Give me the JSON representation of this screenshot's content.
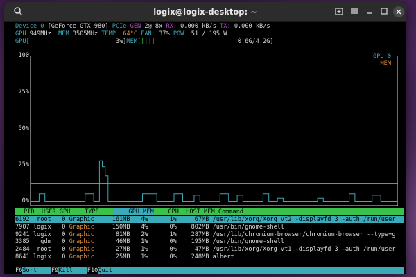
{
  "window": {
    "title": "logix@logix-desktop: ~"
  },
  "icons": {
    "search": "search-icon",
    "new_tab": "new-tab-icon",
    "menu": "hamburger-menu-icon",
    "minimize": "minimize-icon",
    "maximize": "maximize-icon",
    "close": "close-icon"
  },
  "device": {
    "line1": {
      "device_label": "Device",
      "device_id": "0",
      "gpu_name": "[GeForce GTX 980]",
      "pcie_label": "PCIe",
      "gen_label": "GEN",
      "gen_value": "2@ 8x",
      "rx_label": "RX:",
      "rx_value": "0.000 kB/s",
      "tx_label": "TX:",
      "tx_value": "0.000 kB/s"
    },
    "line2": {
      "gpu_label": "GPU",
      "gpu_clock": "949MHz",
      "mem_label": "MEM",
      "mem_clock": "3505MHz",
      "temp_label": "TEMP",
      "temp_value": "64°C",
      "fan_label": "FAN",
      "fan_value": "37%",
      "pow_label": "POW",
      "pow_value": "51 / 195 W"
    },
    "line3": {
      "gpu_label": "GPU[",
      "gpu_value": "3%]",
      "mem_label": "MEM[",
      "mem_bar": "||||",
      "mem_value": "0.6G/4.2G]"
    }
  },
  "chart_data": {
    "type": "line",
    "y_ticks": [
      "100",
      "75%",
      "50%",
      "25%",
      "0%"
    ],
    "ylim": [
      0,
      100
    ],
    "grid": false,
    "legend_position": "top-right",
    "series": [
      {
        "name": "GPU 0",
        "color": "#3aa9b8",
        "values": [
          3,
          3,
          3,
          8,
          8,
          3,
          3,
          3,
          3,
          3,
          3,
          3,
          3,
          3,
          3,
          3,
          3,
          3,
          3,
          8,
          8,
          8,
          3,
          3,
          30,
          26,
          20,
          3,
          3,
          3,
          3,
          3,
          3,
          3,
          3,
          3,
          3,
          3,
          3,
          8,
          8,
          8,
          8,
          8,
          3,
          3,
          3,
          3,
          3,
          3,
          8,
          8,
          8,
          3,
          3,
          3,
          3,
          7,
          7,
          3,
          3,
          3,
          3,
          3,
          3,
          3,
          8,
          8,
          8,
          3,
          3,
          3,
          7,
          7,
          3,
          3,
          3,
          3,
          3,
          3,
          3,
          8,
          8,
          3,
          3,
          3,
          5,
          5,
          3,
          3,
          3,
          3,
          3,
          3,
          3,
          3,
          3,
          3,
          3,
          3,
          5,
          5,
          3,
          3,
          3,
          3,
          3,
          3,
          3,
          3,
          3,
          8,
          8,
          3,
          3,
          3,
          3,
          3,
          3,
          7,
          7,
          7,
          3,
          3,
          3,
          3,
          3,
          3
        ]
      },
      {
        "name": "MEM",
        "color": "#d98a3a",
        "values": [
          15,
          15,
          15,
          15,
          15,
          15,
          15,
          15,
          15,
          15,
          15,
          15,
          15,
          15,
          15,
          15,
          15,
          15,
          15,
          15,
          15,
          15,
          15,
          15,
          15,
          15,
          15,
          15,
          15,
          15,
          15,
          15,
          15,
          15,
          15,
          15,
          15,
          15,
          15,
          15,
          15,
          15,
          15,
          15,
          15,
          15,
          15,
          15,
          15,
          15,
          15,
          15,
          15,
          15,
          15,
          15,
          15,
          15,
          15,
          15,
          15,
          15,
          15,
          15,
          15,
          15,
          15,
          15,
          15,
          15,
          15,
          15,
          15,
          15,
          15,
          15,
          15,
          15,
          15,
          15,
          15,
          15,
          15,
          15,
          15,
          15,
          15,
          15,
          15,
          15,
          15,
          15,
          15,
          15,
          15,
          15,
          15,
          15,
          15,
          15,
          15,
          15,
          15,
          15,
          15,
          15,
          15,
          15,
          15,
          15,
          15,
          15,
          15,
          15,
          15,
          15,
          15,
          15,
          15,
          15,
          15,
          15,
          15,
          15,
          15,
          15,
          15,
          15
        ]
      }
    ]
  },
  "process_table": {
    "columns": [
      "PID",
      "USER",
      "GPU",
      "TYPE",
      "GPU MEM",
      "CPU",
      "HOST MEM",
      "Command"
    ],
    "rows": [
      {
        "pid": "6192",
        "user": "root",
        "gpu": "0",
        "type": "Graphic",
        "gpu_mem": "161MB",
        "gpu_mem_pct": "4%",
        "cpu": "1%",
        "host_mem": "67MB",
        "command": "/usr/lib/xorg/Xorg vt2 -displayfd 3 -auth /run/user"
      },
      {
        "pid": "7907",
        "user": "logix",
        "gpu": "0",
        "type": "Graphic",
        "gpu_mem": "150MB",
        "gpu_mem_pct": "4%",
        "cpu": "0%",
        "host_mem": "802MB",
        "command": "/usr/bin/gnome-shell"
      },
      {
        "pid": "9241",
        "user": "logix",
        "gpu": "0",
        "type": "Graphic",
        "gpu_mem": "81MB",
        "gpu_mem_pct": "2%",
        "cpu": "1%",
        "host_mem": "287MB",
        "command": "/usr/lib/chromium-browser/chromium-browser --type=g"
      },
      {
        "pid": "3385",
        "user": "gdm",
        "gpu": "0",
        "type": "Graphic",
        "gpu_mem": "46MB",
        "gpu_mem_pct": "1%",
        "cpu": "0%",
        "host_mem": "195MB",
        "command": "/usr/bin/gnome-shell"
      },
      {
        "pid": "2484",
        "user": "root",
        "gpu": "0",
        "type": "Graphic",
        "gpu_mem": "27MB",
        "gpu_mem_pct": "1%",
        "cpu": "0%",
        "host_mem": "47MB",
        "command": "/usr/lib/xorg/Xorg vt1 -displayfd 3 -auth /run/user"
      },
      {
        "pid": "8641",
        "user": "logix",
        "gpu": "0",
        "type": "Graphic",
        "gpu_mem": "25MB",
        "gpu_mem_pct": "1%",
        "cpu": "0%",
        "host_mem": "248MB",
        "command": "albert"
      }
    ]
  },
  "footer": [
    {
      "key": "F6",
      "label": "Sort"
    },
    {
      "key": "F9",
      "label": "Kill"
    },
    {
      "key": "F10",
      "label": "Quit"
    }
  ],
  "colors": {
    "cyan": "#3aa9b8",
    "orange": "#d98a3a",
    "green_header": "#3ac24a",
    "magenta": "#b04fc0"
  }
}
